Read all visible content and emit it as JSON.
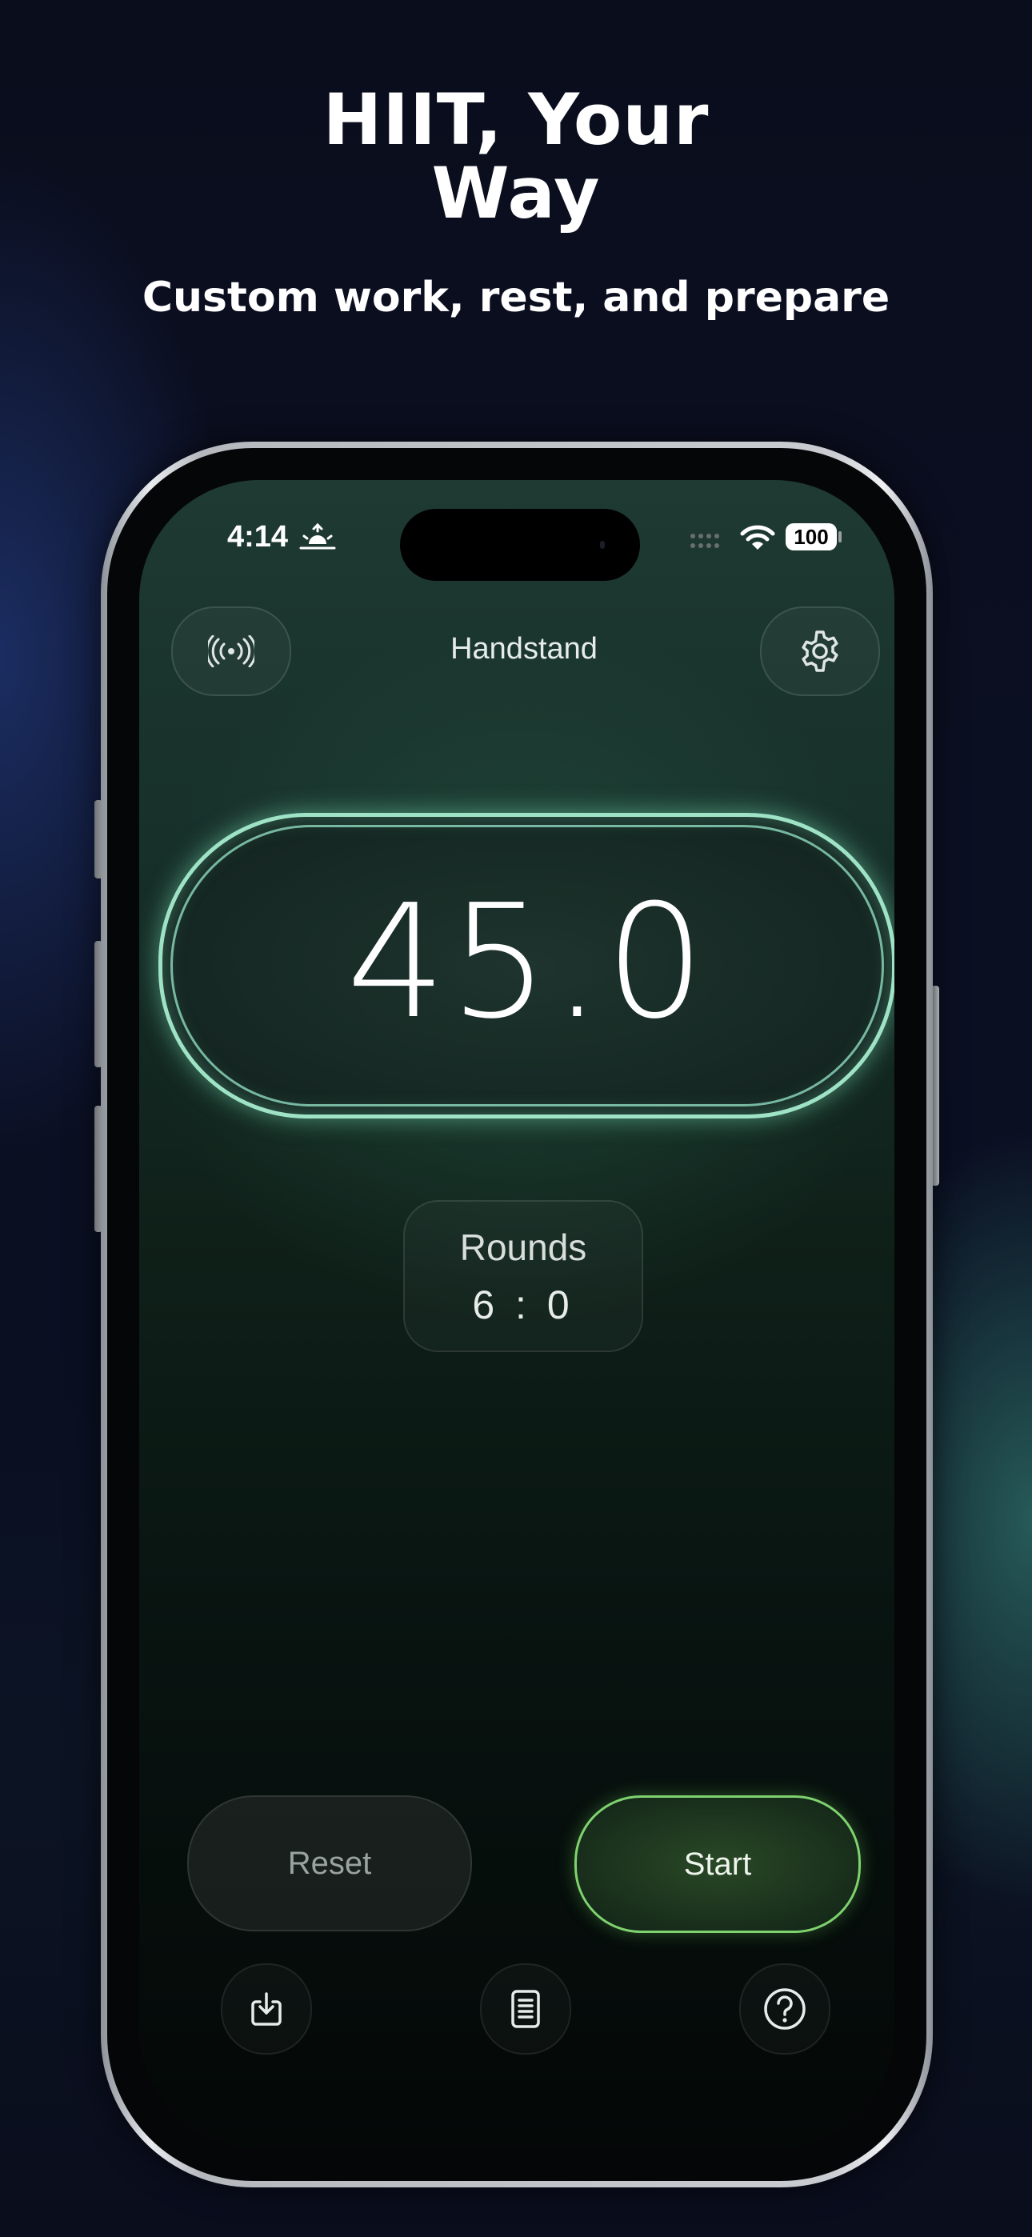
{
  "promo": {
    "headline_line1": "HIIT, Your",
    "headline_line2": "Way",
    "subhead": "Custom work, rest, and prepare"
  },
  "status_bar": {
    "time": "4:14",
    "battery": "100",
    "icons": [
      "sunrise-icon",
      "cellular-signal-icon",
      "wifi-icon",
      "battery-icon"
    ]
  },
  "header": {
    "left_icon": "broadcast-icon",
    "title": "Handstand",
    "right_icon": "gear-icon"
  },
  "timer": {
    "value": "45.0"
  },
  "rounds": {
    "label": "Rounds",
    "value": "6 : 0"
  },
  "actions": {
    "reset_label": "Reset",
    "start_label": "Start"
  },
  "bottom_bar": {
    "icons": [
      "import-icon",
      "list-icon",
      "help-icon"
    ]
  },
  "colors": {
    "timer_ring": "#9fe3c6",
    "start_border": "#7fd36f",
    "background": "#0a0d1c"
  }
}
